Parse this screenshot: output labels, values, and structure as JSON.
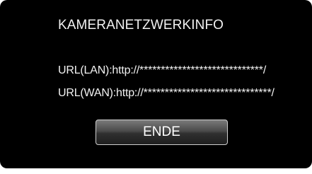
{
  "dialog": {
    "title": "KAMERANETZWERKINFO",
    "url_lan": "URL(LAN):http://*****************************/",
    "url_wan": "URL(WAN):http://******************************/",
    "end_button_label": "ENDE"
  },
  "colors": {
    "background": "#000000",
    "text": "#f2f2f2",
    "button_border": "#cfcfcf"
  }
}
